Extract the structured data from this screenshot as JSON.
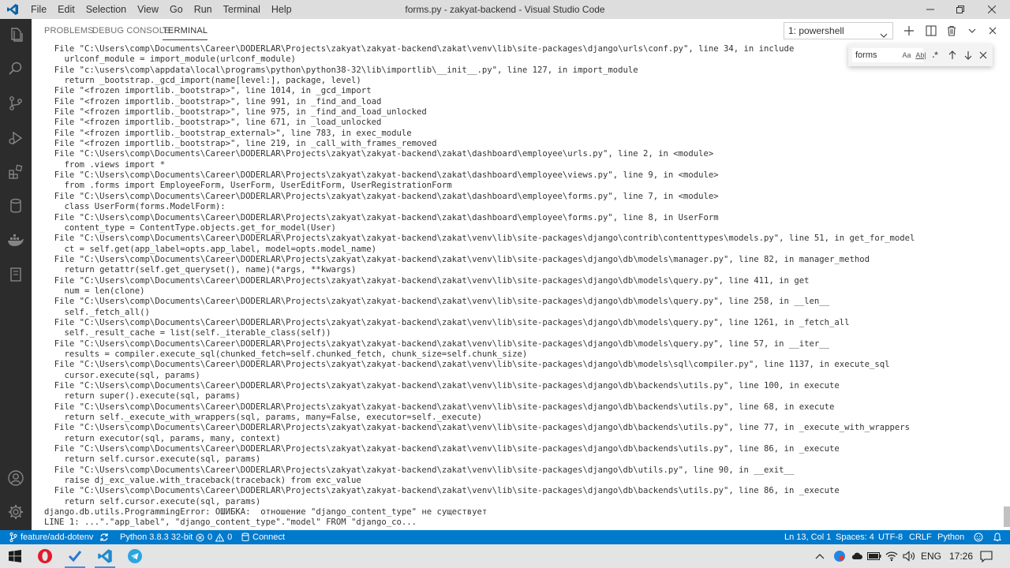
{
  "menu": [
    "File",
    "Edit",
    "Selection",
    "View",
    "Go",
    "Run",
    "Terminal",
    "Help"
  ],
  "window_title": "forms.py - zakyat-backend - Visual Studio Code",
  "panel_tabs": [
    {
      "label": "PROBLEMS"
    },
    {
      "label": "DEBUG CONSOLE"
    },
    {
      "label": "TERMINAL"
    }
  ],
  "terminal_select": "1: powershell",
  "find": {
    "value": "forms",
    "match_case": "Aa",
    "whole_word": "Ab|",
    "regex": ".*"
  },
  "terminal_lines": [
    "  File \"C:\\Users\\comp\\Documents\\Career\\DODERLAR\\Projects\\zakyat\\zakyat-backend\\zakat\\venv\\lib\\site-packages\\django\\urls\\conf.py\", line 34, in include",
    "    urlconf_module = import_module(urlconf_module)",
    "  File \"c:\\users\\comp\\appdata\\local\\programs\\python\\python38-32\\lib\\importlib\\__init__.py\", line 127, in import_module",
    "    return _bootstrap._gcd_import(name[level:], package, level)",
    "  File \"<frozen importlib._bootstrap>\", line 1014, in _gcd_import",
    "  File \"<frozen importlib._bootstrap>\", line 991, in _find_and_load",
    "  File \"<frozen importlib._bootstrap>\", line 975, in _find_and_load_unlocked",
    "  File \"<frozen importlib._bootstrap>\", line 671, in _load_unlocked",
    "  File \"<frozen importlib._bootstrap_external>\", line 783, in exec_module",
    "  File \"<frozen importlib._bootstrap>\", line 219, in _call_with_frames_removed",
    "  File \"C:\\Users\\comp\\Documents\\Career\\DODERLAR\\Projects\\zakyat\\zakyat-backend\\zakat\\dashboard\\employee\\urls.py\", line 2, in <module>",
    "    from .views import *",
    "  File \"C:\\Users\\comp\\Documents\\Career\\DODERLAR\\Projects\\zakyat\\zakyat-backend\\zakat\\dashboard\\employee\\views.py\", line 9, in <module>",
    "    from .forms import EmployeeForm, UserForm, UserEditForm, UserRegistrationForm",
    "  File \"C:\\Users\\comp\\Documents\\Career\\DODERLAR\\Projects\\zakyat\\zakyat-backend\\zakat\\dashboard\\employee\\forms.py\", line 7, in <module>",
    "    class UserForm(forms.ModelForm):",
    "  File \"C:\\Users\\comp\\Documents\\Career\\DODERLAR\\Projects\\zakyat\\zakyat-backend\\zakat\\dashboard\\employee\\forms.py\", line 8, in UserForm",
    "    content_type = ContentType.objects.get_for_model(User)",
    "  File \"C:\\Users\\comp\\Documents\\Career\\DODERLAR\\Projects\\zakyat\\zakyat-backend\\zakat\\venv\\lib\\site-packages\\django\\contrib\\contenttypes\\models.py\", line 51, in get_for_model",
    "    ct = self.get(app_label=opts.app_label, model=opts.model_name)",
    "  File \"C:\\Users\\comp\\Documents\\Career\\DODERLAR\\Projects\\zakyat\\zakyat-backend\\zakat\\venv\\lib\\site-packages\\django\\db\\models\\manager.py\", line 82, in manager_method",
    "    return getattr(self.get_queryset(), name)(*args, **kwargs)",
    "  File \"C:\\Users\\comp\\Documents\\Career\\DODERLAR\\Projects\\zakyat\\zakyat-backend\\zakat\\venv\\lib\\site-packages\\django\\db\\models\\query.py\", line 411, in get",
    "    num = len(clone)",
    "  File \"C:\\Users\\comp\\Documents\\Career\\DODERLAR\\Projects\\zakyat\\zakyat-backend\\zakat\\venv\\lib\\site-packages\\django\\db\\models\\query.py\", line 258, in __len__",
    "    self._fetch_all()",
    "  File \"C:\\Users\\comp\\Documents\\Career\\DODERLAR\\Projects\\zakyat\\zakyat-backend\\zakat\\venv\\lib\\site-packages\\django\\db\\models\\query.py\", line 1261, in _fetch_all",
    "    self._result_cache = list(self._iterable_class(self))",
    "  File \"C:\\Users\\comp\\Documents\\Career\\DODERLAR\\Projects\\zakyat\\zakyat-backend\\zakat\\venv\\lib\\site-packages\\django\\db\\models\\query.py\", line 57, in __iter__",
    "    results = compiler.execute_sql(chunked_fetch=self.chunked_fetch, chunk_size=self.chunk_size)",
    "  File \"C:\\Users\\comp\\Documents\\Career\\DODERLAR\\Projects\\zakyat\\zakyat-backend\\zakat\\venv\\lib\\site-packages\\django\\db\\models\\sql\\compiler.py\", line 1137, in execute_sql",
    "    cursor.execute(sql, params)",
    "  File \"C:\\Users\\comp\\Documents\\Career\\DODERLAR\\Projects\\zakyat\\zakyat-backend\\zakat\\venv\\lib\\site-packages\\django\\db\\backends\\utils.py\", line 100, in execute",
    "    return super().execute(sql, params)",
    "  File \"C:\\Users\\comp\\Documents\\Career\\DODERLAR\\Projects\\zakyat\\zakyat-backend\\zakat\\venv\\lib\\site-packages\\django\\db\\backends\\utils.py\", line 68, in execute",
    "    return self._execute_with_wrappers(sql, params, many=False, executor=self._execute)",
    "  File \"C:\\Users\\comp\\Documents\\Career\\DODERLAR\\Projects\\zakyat\\zakyat-backend\\zakat\\venv\\lib\\site-packages\\django\\db\\backends\\utils.py\", line 77, in _execute_with_wrappers",
    "    return executor(sql, params, many, context)",
    "  File \"C:\\Users\\comp\\Documents\\Career\\DODERLAR\\Projects\\zakyat\\zakyat-backend\\zakat\\venv\\lib\\site-packages\\django\\db\\backends\\utils.py\", line 86, in _execute",
    "    return self.cursor.execute(sql, params)",
    "  File \"C:\\Users\\comp\\Documents\\Career\\DODERLAR\\Projects\\zakyat\\zakyat-backend\\zakat\\venv\\lib\\site-packages\\django\\db\\utils.py\", line 90, in __exit__",
    "    raise dj_exc_value.with_traceback(traceback) from exc_value",
    "  File \"C:\\Users\\comp\\Documents\\Career\\DODERLAR\\Projects\\zakyat\\zakyat-backend\\zakat\\venv\\lib\\site-packages\\django\\db\\backends\\utils.py\", line 86, in _execute",
    "    return self.cursor.execute(sql, params)",
    "django.db.utils.ProgrammingError: ОШИБКА:  отношение \"django_content_type\" не существует",
    "LINE 1: ...\".\"app_label\", \"django_content_type\".\"model\" FROM \"django_co..."
  ],
  "status": {
    "branch": "feature/add-dotenv",
    "python": "Python 3.8.3 32-bit",
    "errors": "0",
    "warnings": "0",
    "connect": "Connect",
    "position": "Ln 13, Col 1",
    "spaces": "Spaces: 4",
    "encoding": "UTF-8",
    "eol": "CRLF",
    "language": "Python"
  },
  "taskbar": {
    "lang": "ENG",
    "time": "17:26"
  },
  "colors": {
    "accent": "#007acc",
    "activity_bar": "#2c2c2c",
    "title_bar": "#dddddd",
    "taskbar": "#e4e4e4"
  }
}
